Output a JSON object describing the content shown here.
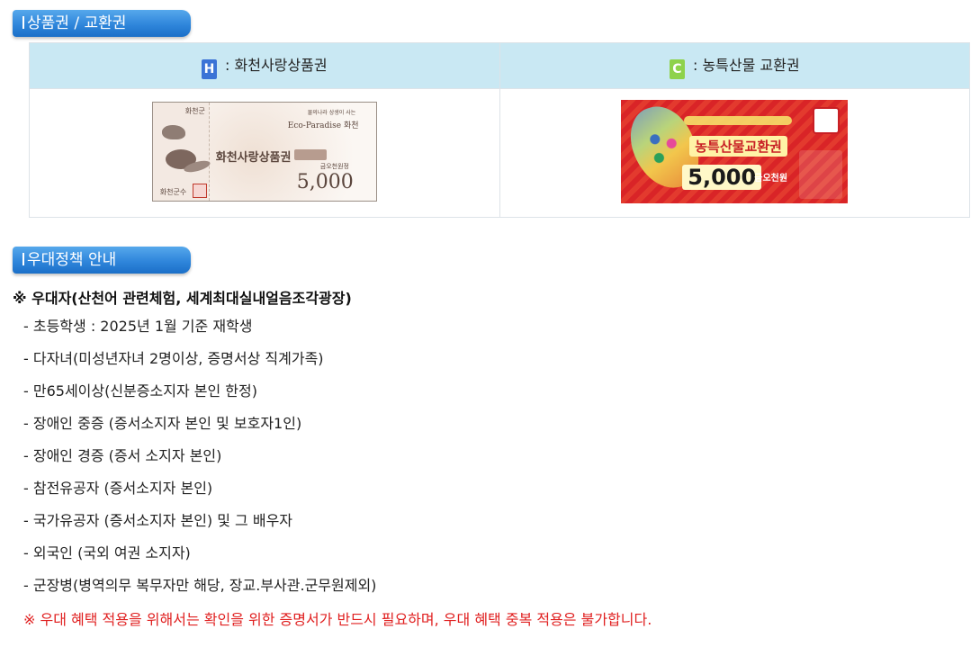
{
  "section1": {
    "title": "상품권 / 교환권",
    "columns": [
      {
        "badge": "H",
        "label": " : 화천사랑상품권",
        "badge_color": "#3b73d6"
      },
      {
        "badge": "C",
        "label": " : 농특산물 교환권",
        "badge_color": "#8ed24b"
      }
    ],
    "voucher_h": {
      "county": "화천군",
      "slogan_small": "물의나라 상생이 사는",
      "slogan": "Eco-Paradise 화천",
      "name": "화천사랑상품권",
      "amount_text": "금오천원정",
      "amount": "5,000",
      "issuer": "화천군수"
    },
    "voucher_c": {
      "title": "농특산물교환권",
      "amount": "5,000",
      "unit": "금오천원"
    }
  },
  "section2": {
    "title": "우대정책 안내",
    "heading": "※ 우대자(산천어 관련체험, 세계최대실내얼음조각광장)",
    "items": [
      "- 초등학생 : 2025년 1월 기준 재학생",
      "- 다자녀(미성년자녀 2명이상, 증명서상 직계가족)",
      "- 만65세이상(신분증소지자 본인 한정)",
      "- 장애인 중증 (증서소지자 본인 및 보호자1인)",
      "- 장애인 경증 (증서 소지자 본인)",
      "- 참전유공자 (증서소지자 본인)",
      "- 국가유공자 (증서소지자 본인) 및 그 배우자",
      "- 외국인 (국외 여권 소지자)",
      "- 군장병(병역의무 복무자만 해당, 장교.부사관.군무원제외)"
    ],
    "note": "※ 우대 혜택 적용을 위해서는 확인을 위한 증명서가 반드시 필요하며, 우대 혜택 중복 적용은 불가합니다."
  }
}
